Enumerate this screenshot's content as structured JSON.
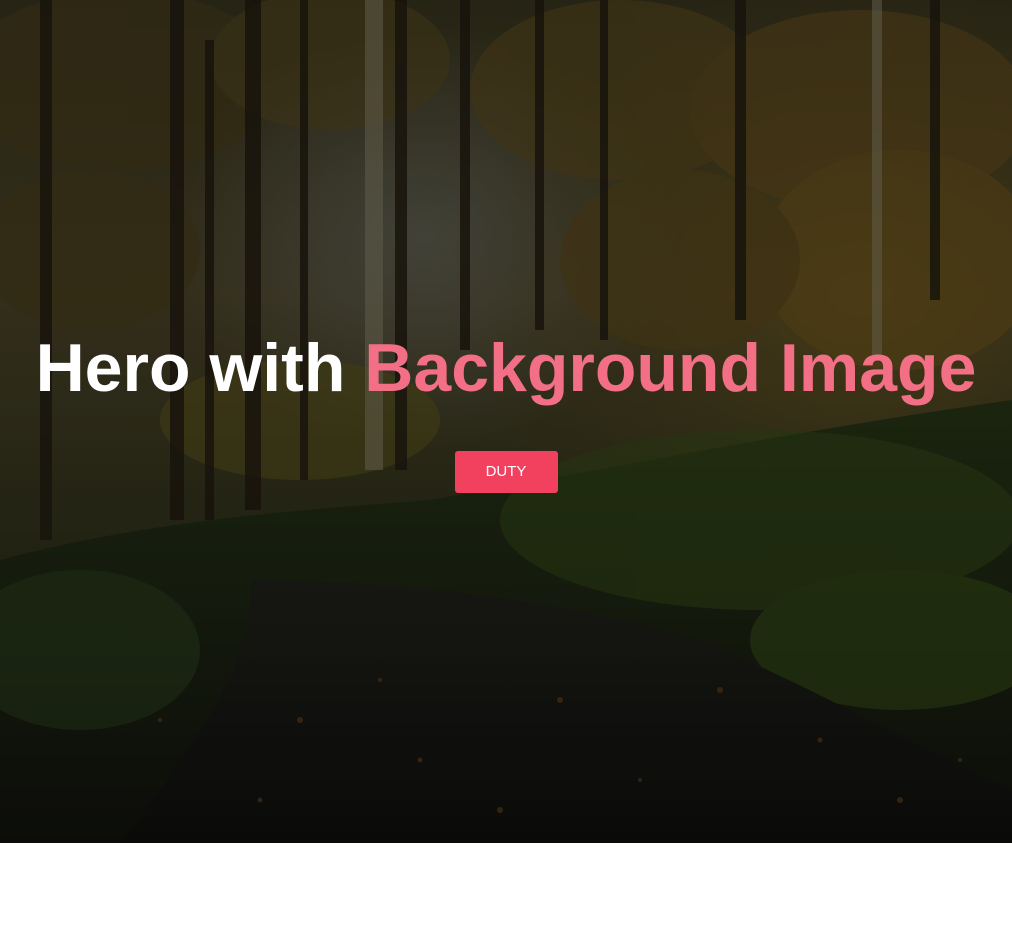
{
  "hero": {
    "title_plain": "Hero with",
    "title_accent": "Background Image",
    "button_label": "DUTY",
    "background_image": "forest-path-autumn",
    "colors": {
      "accent_text": "#f36f86",
      "button_bg": "#f2405f",
      "title_text": "#ffffff"
    }
  }
}
